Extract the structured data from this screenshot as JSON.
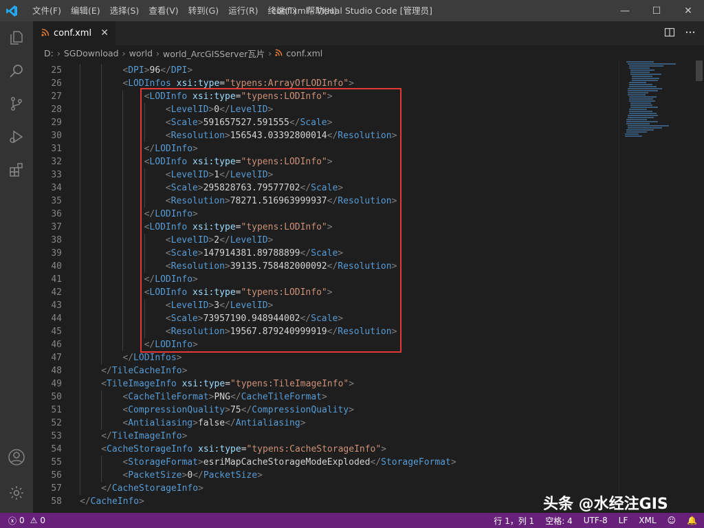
{
  "window": {
    "title": "conf.xml - Visual Studio Code [管理员]",
    "menu": [
      "文件(F)",
      "编辑(E)",
      "选择(S)",
      "查看(V)",
      "转到(G)",
      "运行(R)",
      "终端(T)",
      "帮助(H)"
    ],
    "controls": {
      "minimize": "—",
      "maximize": "☐",
      "close": "✕"
    }
  },
  "activity_bar": {
    "items": [
      "explorer-icon",
      "search-icon",
      "source-control-icon",
      "run-debug-icon",
      "extensions-icon"
    ],
    "bottom": [
      "account-icon",
      "settings-gear-icon"
    ]
  },
  "tab": {
    "label": "conf.xml",
    "close": "✕",
    "actions": [
      "split-editor-icon",
      "more-actions-icon"
    ]
  },
  "breadcrumb": [
    "D:",
    "SGDownload",
    "world",
    "world_ArcGISServer瓦片",
    "conf.xml"
  ],
  "editor": {
    "lines": [
      {
        "n": "25",
        "indent": 2,
        "code": [
          [
            "p",
            "<"
          ],
          [
            "t",
            "DPI"
          ],
          [
            "p",
            ">"
          ],
          [
            "x",
            "96"
          ],
          [
            "p",
            "</"
          ],
          [
            "t",
            "DPI"
          ],
          [
            "p",
            ">"
          ]
        ]
      },
      {
        "n": "26",
        "indent": 2,
        "code": [
          [
            "p",
            "<"
          ],
          [
            "t",
            "LODInfos"
          ],
          [
            "x",
            " "
          ],
          [
            "a",
            "xsi:type"
          ],
          [
            "x",
            "="
          ],
          [
            "s",
            "\"typens:ArrayOfLODInfo\""
          ],
          [
            "p",
            ">"
          ]
        ]
      },
      {
        "n": "27",
        "indent": 3,
        "code": [
          [
            "p",
            "<"
          ],
          [
            "t",
            "LODInfo"
          ],
          [
            "x",
            " "
          ],
          [
            "a",
            "xsi:type"
          ],
          [
            "x",
            "="
          ],
          [
            "s",
            "\"typens:LODInfo\""
          ],
          [
            "p",
            ">"
          ]
        ]
      },
      {
        "n": "28",
        "indent": 4,
        "code": [
          [
            "p",
            "<"
          ],
          [
            "t",
            "LevelID"
          ],
          [
            "p",
            ">"
          ],
          [
            "x",
            "0"
          ],
          [
            "p",
            "</"
          ],
          [
            "t",
            "LevelID"
          ],
          [
            "p",
            ">"
          ]
        ]
      },
      {
        "n": "29",
        "indent": 4,
        "code": [
          [
            "p",
            "<"
          ],
          [
            "t",
            "Scale"
          ],
          [
            "p",
            ">"
          ],
          [
            "x",
            "591657527.591555"
          ],
          [
            "p",
            "</"
          ],
          [
            "t",
            "Scale"
          ],
          [
            "p",
            ">"
          ]
        ]
      },
      {
        "n": "30",
        "indent": 4,
        "code": [
          [
            "p",
            "<"
          ],
          [
            "t",
            "Resolution"
          ],
          [
            "p",
            ">"
          ],
          [
            "x",
            "156543.03392800014"
          ],
          [
            "p",
            "</"
          ],
          [
            "t",
            "Resolution"
          ],
          [
            "p",
            ">"
          ]
        ]
      },
      {
        "n": "31",
        "indent": 3,
        "code": [
          [
            "p",
            "</"
          ],
          [
            "t",
            "LODInfo"
          ],
          [
            "p",
            ">"
          ]
        ]
      },
      {
        "n": "32",
        "indent": 3,
        "code": [
          [
            "p",
            "<"
          ],
          [
            "t",
            "LODInfo"
          ],
          [
            "x",
            " "
          ],
          [
            "a",
            "xsi:type"
          ],
          [
            "x",
            "="
          ],
          [
            "s",
            "\"typens:LODInfo\""
          ],
          [
            "p",
            ">"
          ]
        ]
      },
      {
        "n": "33",
        "indent": 4,
        "code": [
          [
            "p",
            "<"
          ],
          [
            "t",
            "LevelID"
          ],
          [
            "p",
            ">"
          ],
          [
            "x",
            "1"
          ],
          [
            "p",
            "</"
          ],
          [
            "t",
            "LevelID"
          ],
          [
            "p",
            ">"
          ]
        ]
      },
      {
        "n": "34",
        "indent": 4,
        "code": [
          [
            "p",
            "<"
          ],
          [
            "t",
            "Scale"
          ],
          [
            "p",
            ">"
          ],
          [
            "x",
            "295828763.79577702"
          ],
          [
            "p",
            "</"
          ],
          [
            "t",
            "Scale"
          ],
          [
            "p",
            ">"
          ]
        ]
      },
      {
        "n": "35",
        "indent": 4,
        "code": [
          [
            "p",
            "<"
          ],
          [
            "t",
            "Resolution"
          ],
          [
            "p",
            ">"
          ],
          [
            "x",
            "78271.516963999937"
          ],
          [
            "p",
            "</"
          ],
          [
            "t",
            "Resolution"
          ],
          [
            "p",
            ">"
          ]
        ]
      },
      {
        "n": "36",
        "indent": 3,
        "code": [
          [
            "p",
            "</"
          ],
          [
            "t",
            "LODInfo"
          ],
          [
            "p",
            ">"
          ]
        ]
      },
      {
        "n": "37",
        "indent": 3,
        "code": [
          [
            "p",
            "<"
          ],
          [
            "t",
            "LODInfo"
          ],
          [
            "x",
            " "
          ],
          [
            "a",
            "xsi:type"
          ],
          [
            "x",
            "="
          ],
          [
            "s",
            "\"typens:LODInfo\""
          ],
          [
            "p",
            ">"
          ]
        ]
      },
      {
        "n": "38",
        "indent": 4,
        "code": [
          [
            "p",
            "<"
          ],
          [
            "t",
            "LevelID"
          ],
          [
            "p",
            ">"
          ],
          [
            "x",
            "2"
          ],
          [
            "p",
            "</"
          ],
          [
            "t",
            "LevelID"
          ],
          [
            "p",
            ">"
          ]
        ]
      },
      {
        "n": "39",
        "indent": 4,
        "code": [
          [
            "p",
            "<"
          ],
          [
            "t",
            "Scale"
          ],
          [
            "p",
            ">"
          ],
          [
            "x",
            "147914381.89788899"
          ],
          [
            "p",
            "</"
          ],
          [
            "t",
            "Scale"
          ],
          [
            "p",
            ">"
          ]
        ]
      },
      {
        "n": "40",
        "indent": 4,
        "code": [
          [
            "p",
            "<"
          ],
          [
            "t",
            "Resolution"
          ],
          [
            "p",
            ">"
          ],
          [
            "x",
            "39135.758482000092"
          ],
          [
            "p",
            "</"
          ],
          [
            "t",
            "Resolution"
          ],
          [
            "p",
            ">"
          ]
        ]
      },
      {
        "n": "41",
        "indent": 3,
        "code": [
          [
            "p",
            "</"
          ],
          [
            "t",
            "LODInfo"
          ],
          [
            "p",
            ">"
          ]
        ]
      },
      {
        "n": "42",
        "indent": 3,
        "code": [
          [
            "p",
            "<"
          ],
          [
            "t",
            "LODInfo"
          ],
          [
            "x",
            " "
          ],
          [
            "a",
            "xsi:type"
          ],
          [
            "x",
            "="
          ],
          [
            "s",
            "\"typens:LODInfo\""
          ],
          [
            "p",
            ">"
          ]
        ]
      },
      {
        "n": "43",
        "indent": 4,
        "code": [
          [
            "p",
            "<"
          ],
          [
            "t",
            "LevelID"
          ],
          [
            "p",
            ">"
          ],
          [
            "x",
            "3"
          ],
          [
            "p",
            "</"
          ],
          [
            "t",
            "LevelID"
          ],
          [
            "p",
            ">"
          ]
        ]
      },
      {
        "n": "44",
        "indent": 4,
        "code": [
          [
            "p",
            "<"
          ],
          [
            "t",
            "Scale"
          ],
          [
            "p",
            ">"
          ],
          [
            "x",
            "73957190.948944002"
          ],
          [
            "p",
            "</"
          ],
          [
            "t",
            "Scale"
          ],
          [
            "p",
            ">"
          ]
        ]
      },
      {
        "n": "45",
        "indent": 4,
        "code": [
          [
            "p",
            "<"
          ],
          [
            "t",
            "Resolution"
          ],
          [
            "p",
            ">"
          ],
          [
            "x",
            "19567.879240999919"
          ],
          [
            "p",
            "</"
          ],
          [
            "t",
            "Resolution"
          ],
          [
            "p",
            ">"
          ]
        ]
      },
      {
        "n": "46",
        "indent": 3,
        "code": [
          [
            "p",
            "</"
          ],
          [
            "t",
            "LODInfo"
          ],
          [
            "p",
            ">"
          ]
        ]
      },
      {
        "n": "47",
        "indent": 2,
        "code": [
          [
            "p",
            "</"
          ],
          [
            "t",
            "LODInfos"
          ],
          [
            "p",
            ">"
          ]
        ]
      },
      {
        "n": "48",
        "indent": 1,
        "code": [
          [
            "p",
            "</"
          ],
          [
            "t",
            "TileCacheInfo"
          ],
          [
            "p",
            ">"
          ]
        ]
      },
      {
        "n": "49",
        "indent": 1,
        "code": [
          [
            "p",
            "<"
          ],
          [
            "t",
            "TileImageInfo"
          ],
          [
            "x",
            " "
          ],
          [
            "a",
            "xsi:type"
          ],
          [
            "x",
            "="
          ],
          [
            "s",
            "\"typens:TileImageInfo\""
          ],
          [
            "p",
            ">"
          ]
        ]
      },
      {
        "n": "50",
        "indent": 2,
        "code": [
          [
            "p",
            "<"
          ],
          [
            "t",
            "CacheTileFormat"
          ],
          [
            "p",
            ">"
          ],
          [
            "x",
            "PNG"
          ],
          [
            "p",
            "</"
          ],
          [
            "t",
            "CacheTileFormat"
          ],
          [
            "p",
            ">"
          ]
        ]
      },
      {
        "n": "51",
        "indent": 2,
        "code": [
          [
            "p",
            "<"
          ],
          [
            "t",
            "CompressionQuality"
          ],
          [
            "p",
            ">"
          ],
          [
            "x",
            "75"
          ],
          [
            "p",
            "</"
          ],
          [
            "t",
            "CompressionQuality"
          ],
          [
            "p",
            ">"
          ]
        ]
      },
      {
        "n": "52",
        "indent": 2,
        "code": [
          [
            "p",
            "<"
          ],
          [
            "t",
            "Antialiasing"
          ],
          [
            "p",
            ">"
          ],
          [
            "x",
            "false"
          ],
          [
            "p",
            "</"
          ],
          [
            "t",
            "Antialiasing"
          ],
          [
            "p",
            ">"
          ]
        ]
      },
      {
        "n": "53",
        "indent": 1,
        "code": [
          [
            "p",
            "</"
          ],
          [
            "t",
            "TileImageInfo"
          ],
          [
            "p",
            ">"
          ]
        ]
      },
      {
        "n": "54",
        "indent": 1,
        "code": [
          [
            "p",
            "<"
          ],
          [
            "t",
            "CacheStorageInfo"
          ],
          [
            "x",
            " "
          ],
          [
            "a",
            "xsi:type"
          ],
          [
            "x",
            "="
          ],
          [
            "s",
            "\"typens:CacheStorageInfo\""
          ],
          [
            "p",
            ">"
          ]
        ]
      },
      {
        "n": "55",
        "indent": 2,
        "code": [
          [
            "p",
            "<"
          ],
          [
            "t",
            "StorageFormat"
          ],
          [
            "p",
            ">"
          ],
          [
            "x",
            "esriMapCacheStorageModeExploded"
          ],
          [
            "p",
            "</"
          ],
          [
            "t",
            "StorageFormat"
          ],
          [
            "p",
            ">"
          ]
        ]
      },
      {
        "n": "56",
        "indent": 2,
        "code": [
          [
            "p",
            "<"
          ],
          [
            "t",
            "PacketSize"
          ],
          [
            "p",
            ">"
          ],
          [
            "x",
            "0"
          ],
          [
            "p",
            "</"
          ],
          [
            "t",
            "PacketSize"
          ],
          [
            "p",
            ">"
          ]
        ]
      },
      {
        "n": "57",
        "indent": 1,
        "code": [
          [
            "p",
            "</"
          ],
          [
            "t",
            "CacheStorageInfo"
          ],
          [
            "p",
            ">"
          ]
        ]
      },
      {
        "n": "58",
        "indent": 0,
        "code": [
          [
            "p",
            "</"
          ],
          [
            "t",
            "CacheInfo"
          ],
          [
            "p",
            ">"
          ]
        ]
      }
    ]
  },
  "status": {
    "errors": "0",
    "warnings": "0",
    "position": "行 1，列 1",
    "spaces": "空格: 4",
    "encoding": "UTF-8",
    "eol": "LF",
    "language": "XML"
  },
  "watermark": "头条 @水经注GIS",
  "colors": {
    "statusbar": "#68217a",
    "highlight_box": "#e53935",
    "tag": "#569cd6",
    "attr": "#9cdcfe",
    "string": "#ce9178"
  }
}
